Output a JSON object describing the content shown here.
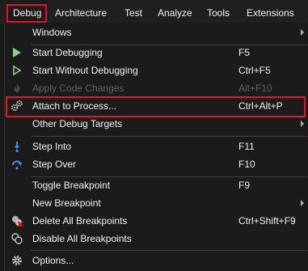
{
  "menubar": {
    "items": [
      "Debug",
      "Architecture",
      "Test",
      "Analyze",
      "Tools",
      "Extensions"
    ],
    "active": "Debug"
  },
  "menu": {
    "items": [
      {
        "label": "Windows",
        "shortcut": "",
        "submenu": true
      },
      {
        "label": "Start Debugging",
        "shortcut": "F5",
        "icon": "play-icon"
      },
      {
        "label": "Start Without Debugging",
        "shortcut": "Ctrl+F5",
        "icon": "play-outline-icon"
      },
      {
        "label": "Apply Code Changes",
        "shortcut": "Alt+F10",
        "icon": "flame-icon",
        "disabled": true
      },
      {
        "label": "Attach to Process...",
        "shortcut": "Ctrl+Alt+P",
        "icon": "gears-icon",
        "highlighted": true
      },
      {
        "label": "Other Debug Targets",
        "shortcut": "",
        "submenu": true
      },
      {
        "label": "Step Into",
        "shortcut": "F11",
        "icon": "step-into-icon"
      },
      {
        "label": "Step Over",
        "shortcut": "F10",
        "icon": "step-over-icon"
      },
      {
        "label": "Toggle Breakpoint",
        "shortcut": "F9"
      },
      {
        "label": "New Breakpoint",
        "shortcut": "",
        "submenu": true
      },
      {
        "label": "Delete All Breakpoints",
        "shortcut": "Ctrl+Shift+F9",
        "icon": "delete-breakpoints-icon"
      },
      {
        "label": "Disable All Breakpoints",
        "shortcut": "",
        "icon": "disable-breakpoints-icon"
      },
      {
        "label": "Options...",
        "shortcut": "",
        "icon": "gear-icon"
      }
    ]
  },
  "colors": {
    "highlight_border": "#e81123",
    "play_green": "#89d185",
    "step_blue": "#3794ff"
  }
}
